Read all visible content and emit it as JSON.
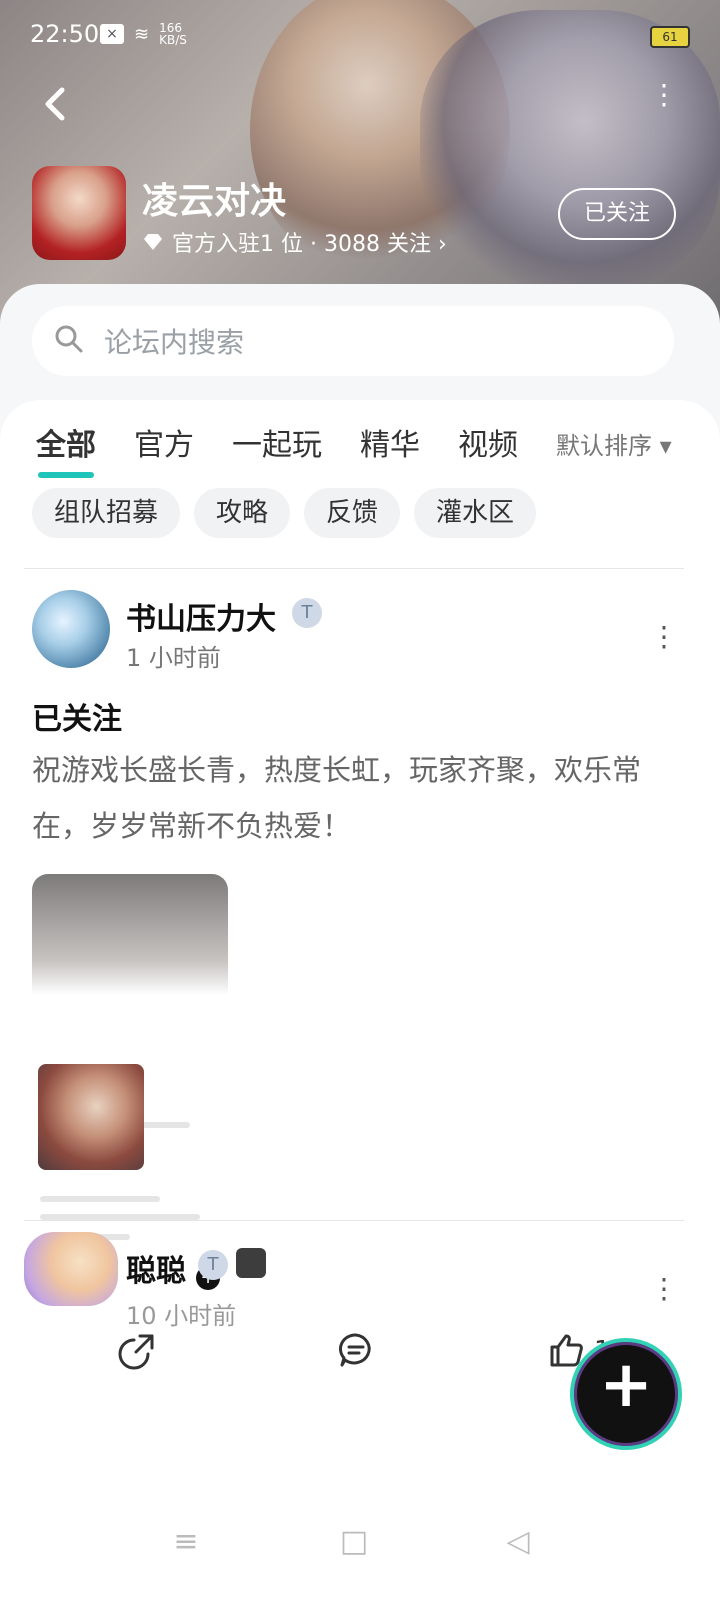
{
  "status_bar": {
    "time": "22:50",
    "speed_value": "166",
    "speed_unit": "KB/S",
    "battery": "61"
  },
  "header": {
    "forum_name": "凌云对决",
    "meta": "官方入驻1 位 · 3088 关注 ›",
    "follow_label": "已关注"
  },
  "search": {
    "placeholder": "论坛内搜索"
  },
  "tabs": {
    "items": [
      "全部",
      "官方",
      "一起玩",
      "精华",
      "视频"
    ],
    "sort_label": "默认排序 ▾"
  },
  "chips": [
    "组队招募",
    "攻略",
    "反馈",
    "灌水区"
  ],
  "posts": [
    {
      "author": "书山压力大",
      "time": "1 小时前",
      "title": "已关注",
      "text": "祝游戏长盛长青，热度长虹，玩家齐聚，欢乐常在，岁岁常新不负热爱！",
      "likes": "1"
    },
    {
      "author": "聪聪",
      "time": "10 小时前"
    }
  ],
  "icons": {
    "back": "chevron-left-icon",
    "more": "more-vertical-icon",
    "search": "search-icon",
    "share": "share-icon",
    "comment": "comment-icon",
    "like": "thumb-up-icon",
    "fab": "plus-icon",
    "nav_menu": "menu-icon",
    "nav_home": "square-icon",
    "nav_back": "triangle-back-icon"
  },
  "colors": {
    "accent": "#1ec5b8"
  }
}
